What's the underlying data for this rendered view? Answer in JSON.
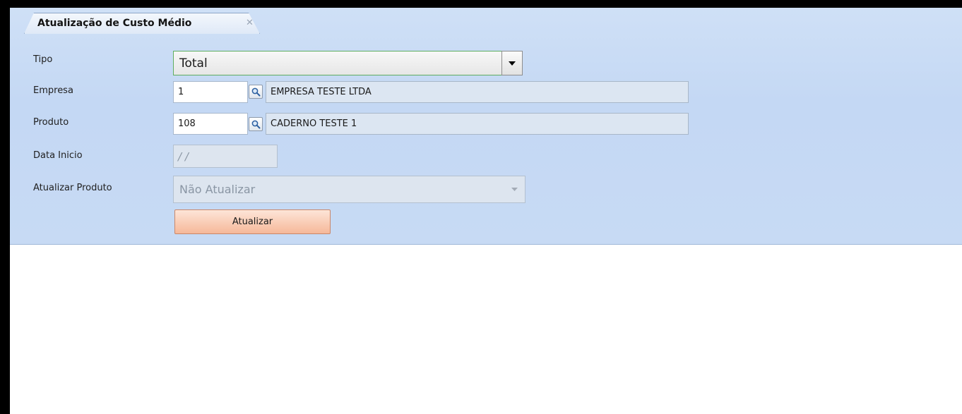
{
  "tab": {
    "title": "Atualização de Custo Médio",
    "close_glyph": "✕"
  },
  "form": {
    "tipo": {
      "label": "Tipo",
      "value": "Total"
    },
    "empresa": {
      "label": "Empresa",
      "code": "1",
      "description": "EMPRESA TESTE LTDA"
    },
    "produto": {
      "label": "Produto",
      "code": "108",
      "description": "CADERNO TESTE 1"
    },
    "data_inicio": {
      "label": "Data Inicio",
      "value": "/ /"
    },
    "atualizar_produto": {
      "label": "Atualizar Produto",
      "value": "Não Atualizar"
    },
    "atualizar_button": "Atualizar"
  },
  "icons": [
    "close-icon",
    "chevron-down-icon",
    "search-icon"
  ],
  "colors": {
    "panel": "#c7daf4",
    "button": "#f6b899",
    "combo_border": "#5fae60"
  }
}
